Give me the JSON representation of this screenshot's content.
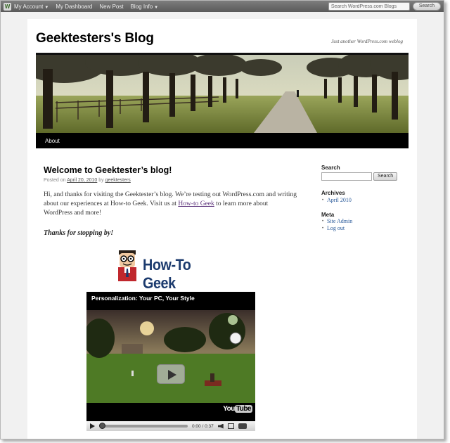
{
  "admin_bar": {
    "items": [
      {
        "label": "My Account",
        "has_menu": true
      },
      {
        "label": "My Dashboard",
        "has_menu": false
      },
      {
        "label": "New Post",
        "has_menu": false
      },
      {
        "label": "Blog Info",
        "has_menu": true
      }
    ],
    "search_placeholder": "Search WordPress.com Blogs",
    "search_button": "Search"
  },
  "site": {
    "title": "Geektesters's Blog",
    "tagline": "Just another WordPress.com weblog"
  },
  "nav": {
    "items": [
      "About"
    ]
  },
  "post": {
    "title": "Welcome to Geektester’s blog!",
    "posted_on": "Posted on",
    "date": "April 20, 2010",
    "by": "by",
    "author": "geektesters",
    "body_before_link": "Hi, and thanks for visiting the Geektester’s blog.  We’re testing out WordPress.com and writing about our experiences at How-to Geek.  Visit us at ",
    "link_text": "How-to Geek",
    "body_after_link": " to learn more about WordPress and more!",
    "thanks": "Thanks for stopping by!"
  },
  "logo": {
    "text": "How-To Geek"
  },
  "video": {
    "title": "Personalization: Your PC, Your Style",
    "time": "0:00 / 0:37",
    "progress": 0,
    "brand_you": "You",
    "brand_tube": "Tube"
  },
  "sidebar": {
    "search_heading": "Search",
    "search_button": "Search",
    "archives_heading": "Archives",
    "archives": [
      "April 2010"
    ],
    "meta_heading": "Meta",
    "meta": [
      "Site Admin",
      "Log out"
    ]
  },
  "colors": {
    "admin_bar": "#6b6b6b",
    "nav_bar": "#000000",
    "link": "#2a5a9a",
    "visited_link": "#5a3079",
    "logo_blue": "#1c3b6e"
  }
}
